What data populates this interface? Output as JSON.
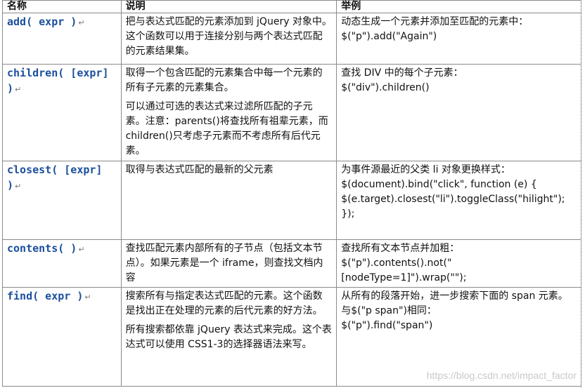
{
  "headers": {
    "name": "名称",
    "desc": "说明",
    "example": "举例"
  },
  "para_mark": "↵",
  "rows": [
    {
      "name": "add( expr )",
      "desc": [
        "把与表达式匹配的元素添加到 jQuery 对象中。这个函数可以用于连接分别与两个表达式匹配的元素结果集。"
      ],
      "example": [
        "动态生成一个元素并添加至匹配的元素中：",
        "$(\"p\").add(\"Again\")"
      ]
    },
    {
      "name": "children( [expr] )",
      "desc": [
        "取得一个包含匹配的元素集合中每一个元素的所有子元素的元素集合。",
        "可以通过可选的表达式来过滤所匹配的子元素。注意：parents()将查找所有祖辈元素，而 children()只考虑子元素而不考虑所有后代元素。"
      ],
      "example": [
        "查找 DIV 中的每个子元素：",
        "$(\"div\").children()"
      ]
    },
    {
      "name": "closest( [expr] )",
      "desc": [
        "取得与表达式匹配的最新的父元素"
      ],
      "example": [
        "为事件源最近的父类 li 对象更换样式：",
        "$(document).bind(\"click\", function (e) { $(e.target).closest(\"li\").toggleClass(\"hilight\");",
        "});"
      ]
    },
    {
      "name": "contents( )",
      "desc": [
        "查找匹配元素内部所有的子节点（包括文本节点）。如果元素是一个 iframe，则查找文档内容"
      ],
      "example": [
        "查找所有文本节点并加粗：",
        "$(\"p\").contents().not(\"[nodeType=1]\").wrap(\"\");"
      ]
    },
    {
      "name": "find( expr )",
      "desc": [
        "搜索所有与指定表达式匹配的元素。这个函数是找出正在处理的元素的后代元素的好方法。",
        "所有搜索都依靠 jQuery 表达式来完成。这个表达式可以使用 CSS1-3的选择器语法来写。"
      ],
      "example": [
        "从所有的段落开始，进一步搜索下面的 span 元素。与$(\"p span\")相同：",
        "$(\"p\").find(\"span\")"
      ]
    }
  ],
  "watermark": "https://blog.csdn.net/impact_factor"
}
